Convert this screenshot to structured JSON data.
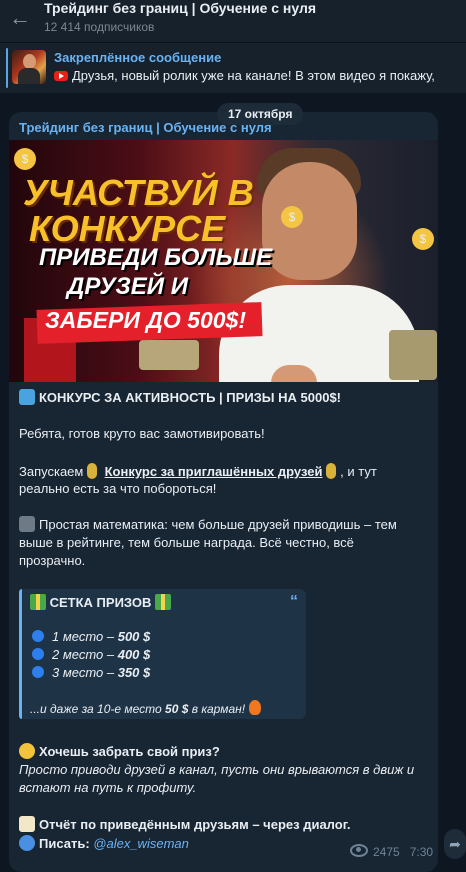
{
  "header": {
    "title": "Трейдинг без границ | Обучение с нуля",
    "subscribers": "12 414 подписчиков"
  },
  "pinned": {
    "title": "Закреплённое сообщение",
    "text": "Друзья, новый ролик уже на канале!  В этом видео я покажу,"
  },
  "date": "17 октября",
  "message": {
    "channel": "Трейдинг без границ | Обучение с нуля",
    "banner": {
      "line1": "УЧАСТВУЙ В",
      "line2": "КОНКУРСЕ",
      "line3": "ПРИВЕДИ БОЛЬШЕ",
      "line4": "ДРУЗЕЙ И",
      "line5": "ЗАБЕРИ ДО 500$!"
    },
    "heading": "КОНКУРС ЗА АКТИВНОСТЬ | ПРИЗЫ НА 5000$!",
    "p1": "Ребята, готов круто вас замотивировать!",
    "p2_start": "Запускаем",
    "p2_link": "Конкурс за приглашённых друзей",
    "p2_end": ", и тут",
    "p2_line2": "реально есть за что побороться!",
    "p3_line1": "Простая математика: чем больше друзей приводишь – тем",
    "p3_line2": "выше в рейтинге, тем больше награда. Всё честно, всё",
    "p3_line3": "прозрачно.",
    "quote": {
      "title": "СЕТКА ПРИЗОВ",
      "place1_label": "1 место –",
      "place1_value": "500 $",
      "place2_label": "2 место –",
      "place2_value": "400 $",
      "place3_label": "3 место –",
      "place3_value": "350 $",
      "footer_start": "...и даже за 10-е место",
      "footer_value": "50 $",
      "footer_end": "в карман!"
    },
    "cta_title": "Хочешь забрать свой приз?",
    "cta_line1": "Просто приводи друзей в канал, пусть они врываются в движ и",
    "cta_line2": "встают на путь к профиту.",
    "report": "Отчёт по приведённым друзьям – через диалог.",
    "write_label": "Писать:",
    "write_handle": "@alex_wiseman",
    "views": "2475",
    "time": "7:30"
  }
}
